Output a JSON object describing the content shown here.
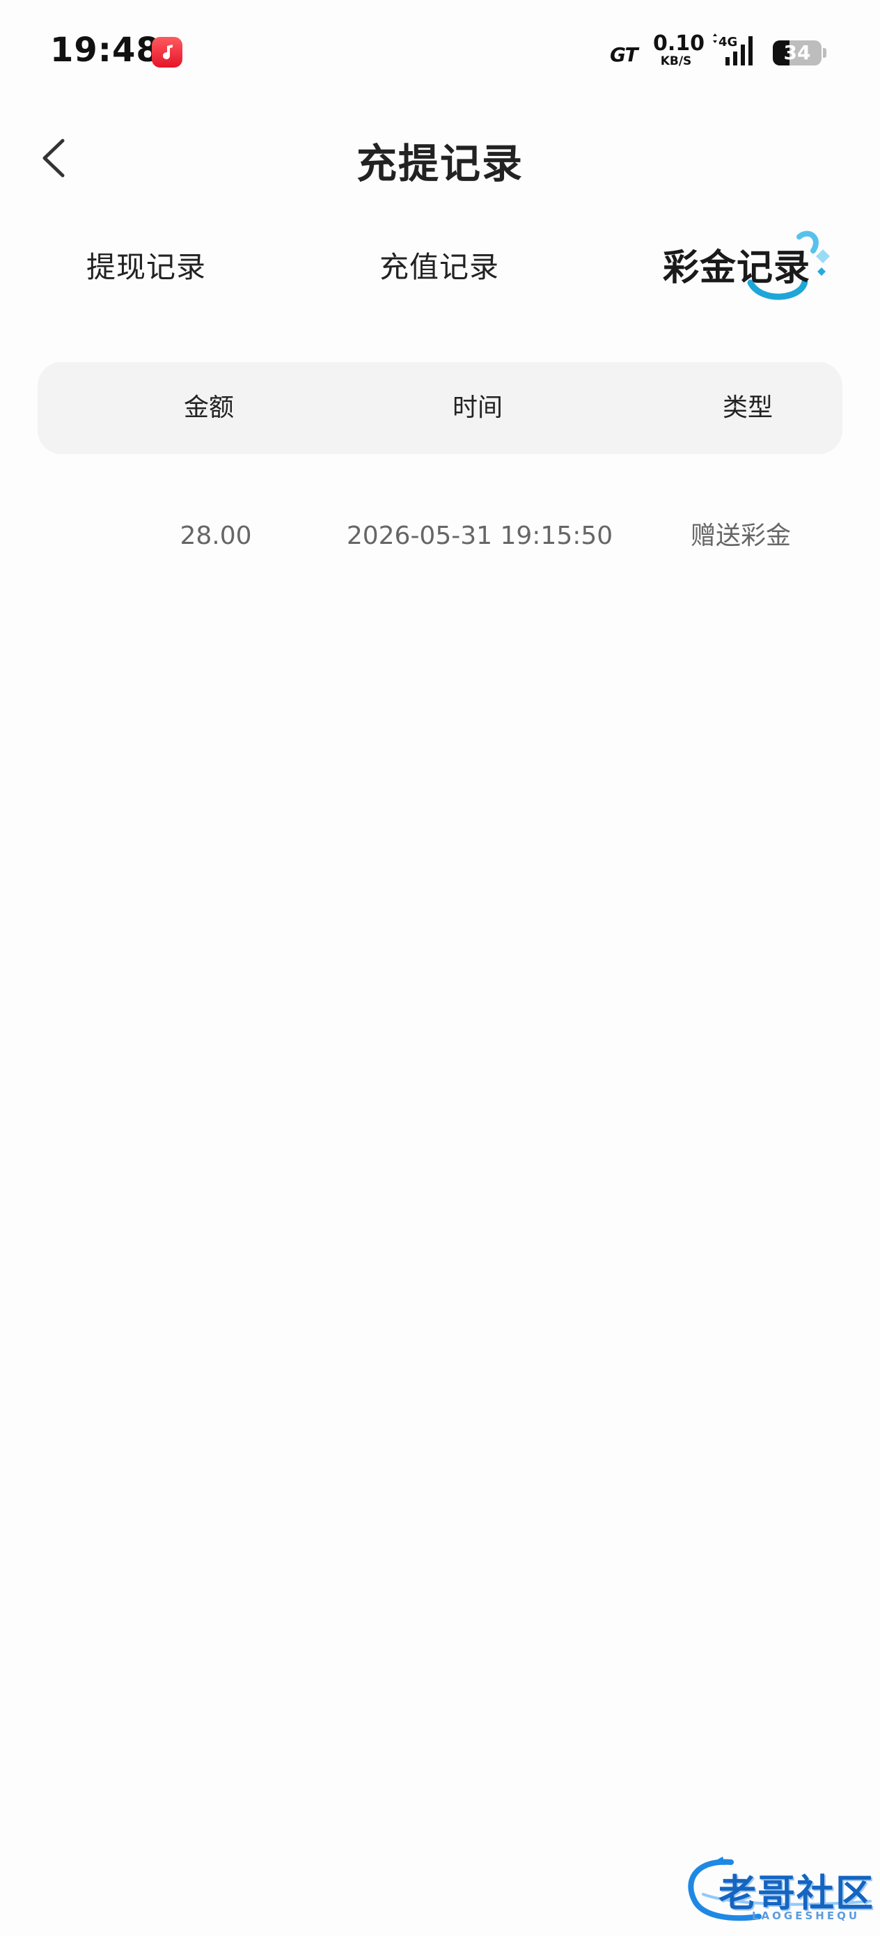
{
  "status_bar": {
    "time": "19:48",
    "network_brand": "GT",
    "net_speed_value": "0.10",
    "net_speed_unit": "KB/S",
    "signal_type": "4G",
    "battery_level": "34"
  },
  "header": {
    "title": "充提记录"
  },
  "tabs": [
    {
      "label": "提现记录",
      "active": false
    },
    {
      "label": "充值记录",
      "active": false
    },
    {
      "label": "彩金记录",
      "active": true
    }
  ],
  "table": {
    "columns": [
      "金额",
      "时间",
      "类型"
    ],
    "rows": [
      {
        "amount": "28.00",
        "time": "2026-05-31 19:15:50",
        "type": "赠送彩金"
      }
    ]
  },
  "watermark": {
    "text": "老哥社区",
    "subtext": "LAOGESHEQU"
  },
  "colors": {
    "accent_tab_decoration": "#29a9e1",
    "table_header_bg": "#f3f3f3",
    "music_icon": "#e5142a",
    "watermark": "#1565c0"
  }
}
